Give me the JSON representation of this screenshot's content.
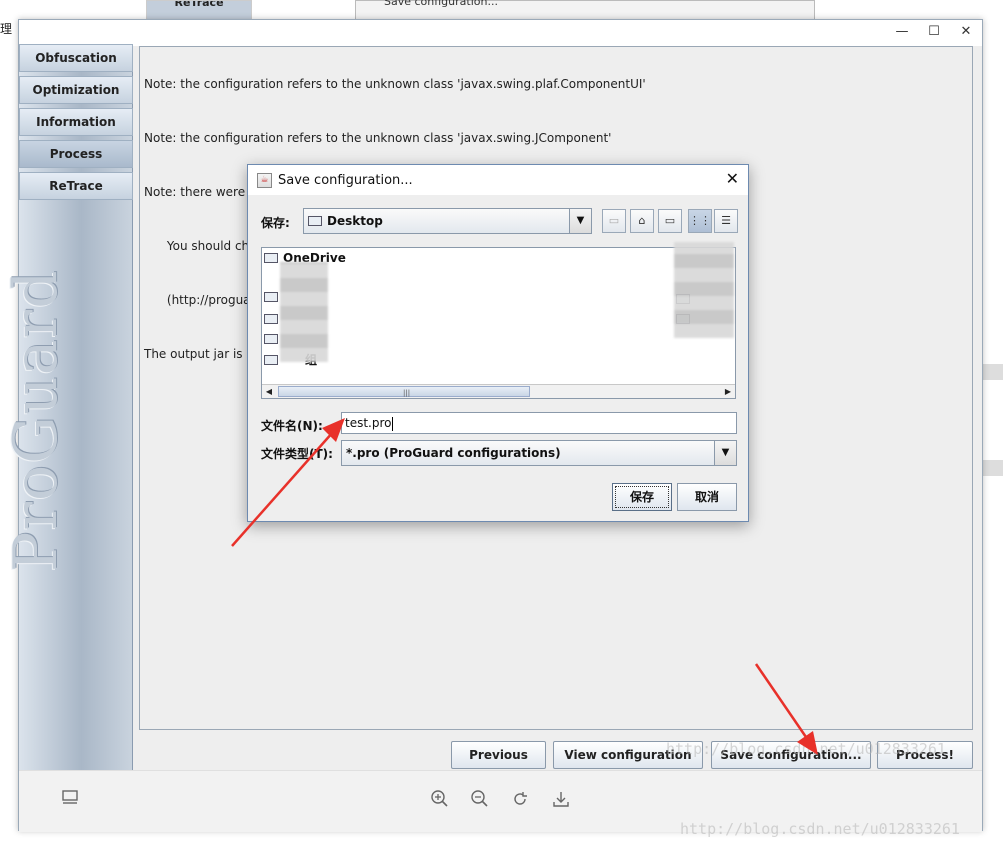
{
  "edge_char": "理",
  "background": {
    "retrace_tab": "ReTrace",
    "save_dialog_title": "Save configuration...",
    "close": "×"
  },
  "window": {
    "controls": {
      "minimize": "—",
      "maximize": "☐",
      "close": "✕"
    },
    "nav": [
      {
        "label": "Obfuscation"
      },
      {
        "label": "Optimization"
      },
      {
        "label": "Information"
      },
      {
        "label": "Process",
        "active": true
      },
      {
        "label": "ReTrace"
      }
    ],
    "logo": "ProGuard",
    "log_lines": [
      "Note: the configuration refers to the unknown class 'javax.swing.plaf.ComponentUI'",
      "Note: the configuration refers to the unknown class 'javax.swing.JComponent'",
      "Note: there were 3 references to unknown classes.",
      "      You should check your configuration for typos.",
      "      (http://proguard.sourceforge.net/manual/troubleshooting.html#unknownclass)",
      "The output jar is empty. Did you specify the proper '-keep' options?"
    ],
    "buttons": {
      "previous": "Previous",
      "view_configuration": "View configuration",
      "save_configuration": "Save configuration...",
      "process": "Process!"
    }
  },
  "dialog": {
    "title": "Save configuration...",
    "close": "✕",
    "save_in_label": "保存:",
    "location": "Desktop",
    "files": [
      "OneDrive"
    ],
    "filename_label": "文件名(N):",
    "filename_value": "test.pro",
    "filetype_label": "文件类型(T):",
    "filetype_value": "*.pro (ProGuard configurations)",
    "partial_item": "组",
    "save_button": "保存",
    "cancel_button": "取消"
  },
  "watermark": "http://blog.csdn.net/u012833261",
  "colors": {
    "arrow": "#e8312a",
    "nav_gradient_top": "#e6edf5",
    "dialog_border": "#6d8ab0"
  }
}
